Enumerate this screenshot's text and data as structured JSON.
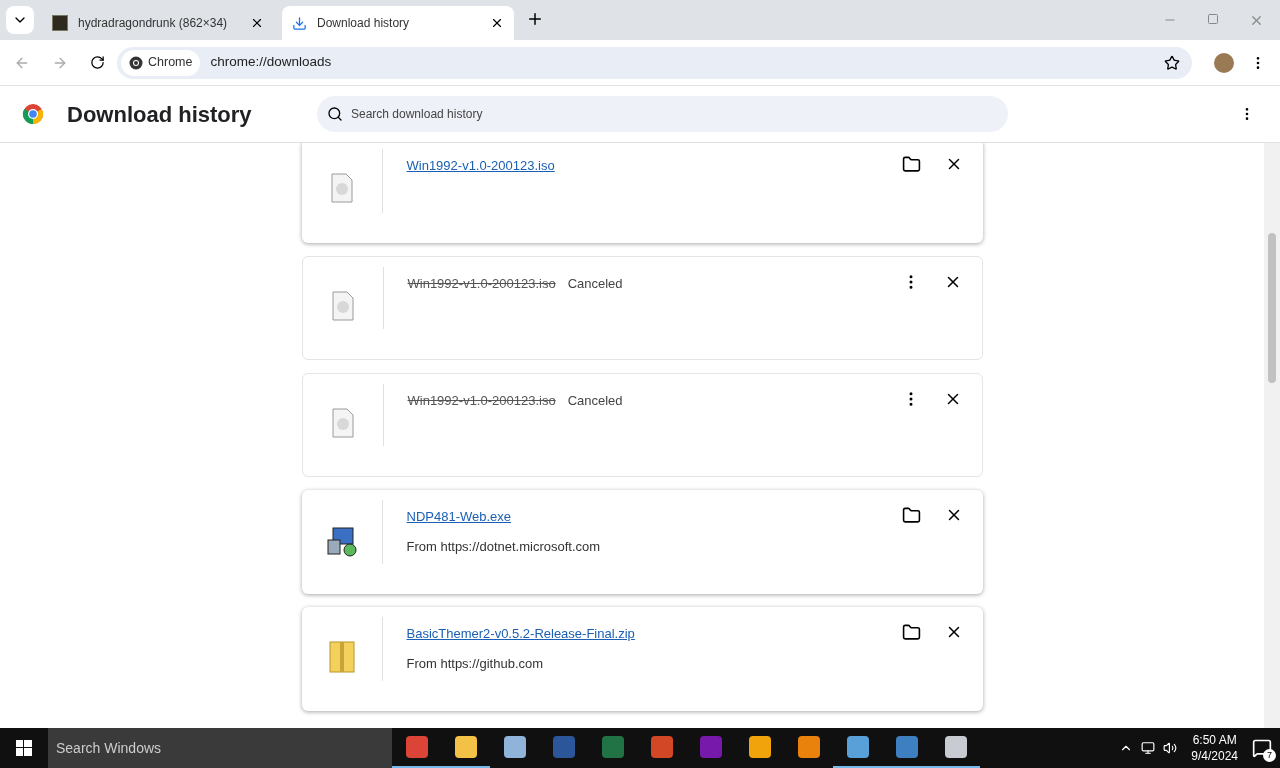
{
  "tabs": [
    {
      "title": "hydradragondrunk (862×34)",
      "kind": "image",
      "selected": false
    },
    {
      "title": "Download history",
      "kind": "download",
      "selected": true
    }
  ],
  "omnibox": {
    "chip": "Chrome",
    "url": "chrome://downloads"
  },
  "page": {
    "title": "Download history",
    "search_placeholder": "Search download history"
  },
  "downloads": [
    {
      "kind": "complete",
      "name": "Win1992-v1.0-200123.iso"
    },
    {
      "kind": "canceled",
      "name": "Win1992-v1.0-200123.iso",
      "status": "Canceled"
    },
    {
      "kind": "canceled",
      "name": "Win1992-v1.0-200123.iso",
      "status": "Canceled"
    },
    {
      "kind": "complete",
      "name": "NDP481-Web.exe",
      "source": "From https://dotnet.microsoft.com"
    },
    {
      "kind": "complete",
      "name": "BasicThemer2-v0.5.2-Release-Final.zip",
      "source": "From https://github.com"
    }
  ],
  "taskbar": {
    "search_placeholder": "Search Windows",
    "apps": [
      {
        "kind": "chrome",
        "running": true
      },
      {
        "kind": "explorer",
        "running": true
      },
      {
        "kind": "paint",
        "running": false
      },
      {
        "kind": "word",
        "running": false
      },
      {
        "kind": "excel",
        "running": false
      },
      {
        "kind": "powerpoint",
        "running": false
      },
      {
        "kind": "onenote",
        "running": false
      },
      {
        "kind": "outlook",
        "running": false
      },
      {
        "kind": "orb",
        "running": false
      },
      {
        "kind": "cube",
        "running": true
      },
      {
        "kind": "vm",
        "running": true
      },
      {
        "kind": "remote",
        "running": true
      }
    ],
    "time": "6:50 AM",
    "date": "9/4/2024",
    "notifications": "7"
  }
}
